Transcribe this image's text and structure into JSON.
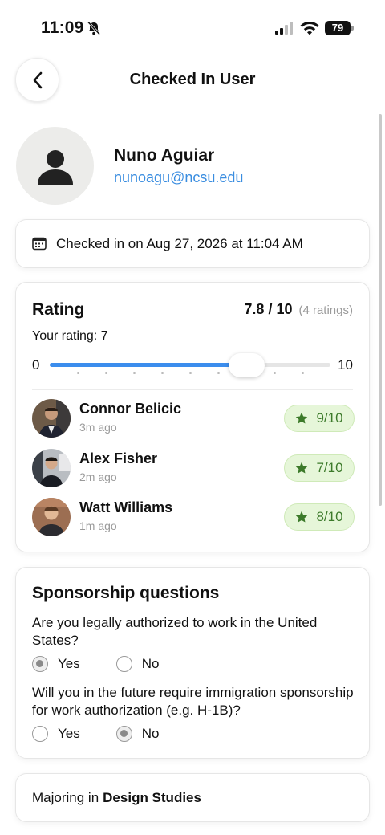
{
  "status_bar": {
    "time": "11:09",
    "battery": "79"
  },
  "nav": {
    "title": "Checked In User"
  },
  "profile": {
    "name": "Nuno Aguiar",
    "email": "nunoagu@ncsu.edu"
  },
  "checkin": {
    "text": "Checked in on Aug 27, 2026 at 11:04 AM"
  },
  "rating": {
    "title": "Rating",
    "average": "7.8 / 10",
    "count": "(4 ratings)",
    "your_rating_label": "Your rating: 7",
    "slider": {
      "min_label": "0",
      "max_label": "10",
      "value": 7,
      "min": 0,
      "max": 10
    },
    "raters": [
      {
        "name": "Connor Belicic",
        "time": "3m ago",
        "score": "9/10"
      },
      {
        "name": "Alex Fisher",
        "time": "2m ago",
        "score": "7/10"
      },
      {
        "name": "Watt Williams",
        "time": "1m ago",
        "score": "8/10"
      }
    ]
  },
  "sponsorship": {
    "title": "Sponsorship questions",
    "questions": [
      {
        "text": "Are you legally authorized to work in the United States?",
        "options": [
          "Yes",
          "No"
        ],
        "selected": "Yes"
      },
      {
        "text": "Will you in the future require immigration sponsorship for work authorization (e.g. H-1B)?",
        "options": [
          "Yes",
          "No"
        ],
        "selected": "No"
      }
    ]
  },
  "major": {
    "prefix": "Majoring in",
    "value": "Design Studies"
  },
  "colors": {
    "accent": "#3b8ded",
    "email": "#3a8de0",
    "badge_bg": "#e6f6d9",
    "badge_text": "#3c7a2a"
  }
}
